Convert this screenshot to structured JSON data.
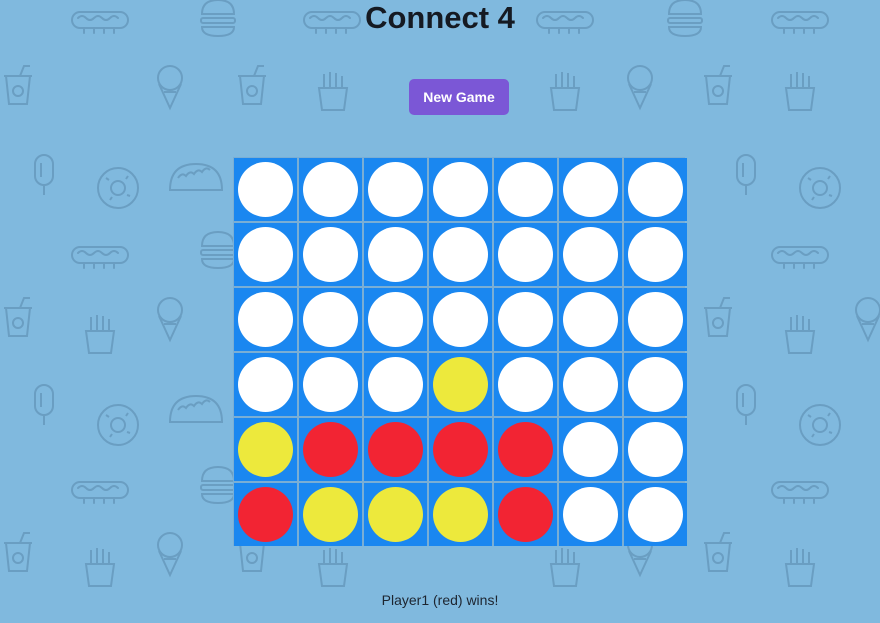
{
  "title": "Connect 4",
  "new_game_label": "New Game",
  "status": "Player1 (red) wins!",
  "colors": {
    "board": "#1a87f0",
    "empty": "#ffffff",
    "red": "#f22433",
    "yellow": "#ede93c",
    "background": "#80b9de",
    "button": "#7b57d6"
  },
  "board": {
    "columns": 7,
    "rows": 6,
    "cells": [
      [
        "empty",
        "empty",
        "empty",
        "empty",
        "empty",
        "empty",
        "empty"
      ],
      [
        "empty",
        "empty",
        "empty",
        "empty",
        "empty",
        "empty",
        "empty"
      ],
      [
        "empty",
        "empty",
        "empty",
        "empty",
        "empty",
        "empty",
        "empty"
      ],
      [
        "empty",
        "empty",
        "empty",
        "yellow",
        "empty",
        "empty",
        "empty"
      ],
      [
        "yellow",
        "red",
        "red",
        "red",
        "red",
        "empty",
        "empty"
      ],
      [
        "red",
        "yellow",
        "yellow",
        "yellow",
        "red",
        "empty",
        "empty"
      ]
    ]
  },
  "background_pattern_icons": [
    "hotdog-icon",
    "burger-icon",
    "soda-cup-icon",
    "ice-cream-cone-icon",
    "fries-icon",
    "popsicle-icon",
    "donut-icon",
    "taco-icon"
  ]
}
